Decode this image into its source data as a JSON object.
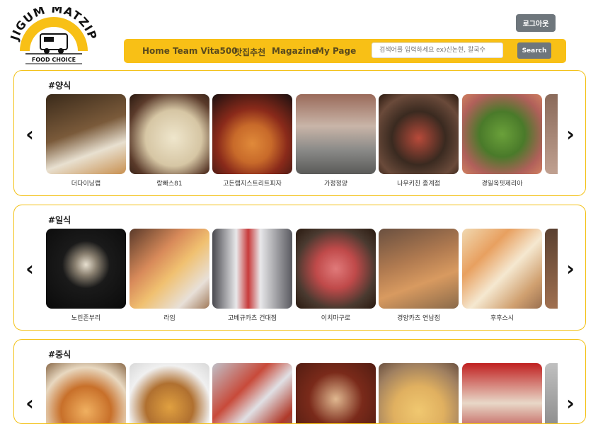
{
  "logo": {
    "top_text": "JIGUM MATZIP",
    "sub_text": "FOOD CHOICE"
  },
  "header": {
    "logout_label": "로그아웃"
  },
  "nav": {
    "items": [
      "Home",
      "Team Vita500",
      "맛집추천",
      "Magazine",
      "My Page"
    ],
    "search_placeholder": "검색어를 입력하세요 ex)신논현, 칼국수",
    "search_label": "Search"
  },
  "sections": [
    {
      "title": "#양식",
      "items": [
        {
          "name": "더다이닝랩",
          "color": "#7a5a3a"
        },
        {
          "name": "랑빠스81",
          "color": "#d6c6a4"
        },
        {
          "name": "고든램지스트리트피자",
          "color": "#b23a2a"
        },
        {
          "name": "가정정양",
          "color": "#b9b4b0"
        },
        {
          "name": "나우키친 종계점",
          "color": "#5a3a2a"
        },
        {
          "name": "경일옥핏제리아",
          "color": "#6b8a3a"
        }
      ]
    },
    {
      "title": "#일식",
      "items": [
        {
          "name": "노린존부리",
          "color": "#1a1a1a"
        },
        {
          "name": "라임",
          "color": "#a87a5a"
        },
        {
          "name": "고베규카츠 건대점",
          "color": "#7a7a80"
        },
        {
          "name": "이치마구로",
          "color": "#4a3a30"
        },
        {
          "name": "경양카츠 연남점",
          "color": "#b07a50"
        },
        {
          "name": "후후스시",
          "color": "#e0c090"
        }
      ]
    },
    {
      "title": "#중식",
      "items": [
        {
          "name": "",
          "color": "#c8702a"
        },
        {
          "name": "",
          "color": "#d09040"
        },
        {
          "name": "",
          "color": "#8a8a90"
        },
        {
          "name": "",
          "color": "#7a2a1a"
        },
        {
          "name": "",
          "color": "#e0b060"
        },
        {
          "name": "",
          "color": "#b02020"
        }
      ]
    }
  ]
}
